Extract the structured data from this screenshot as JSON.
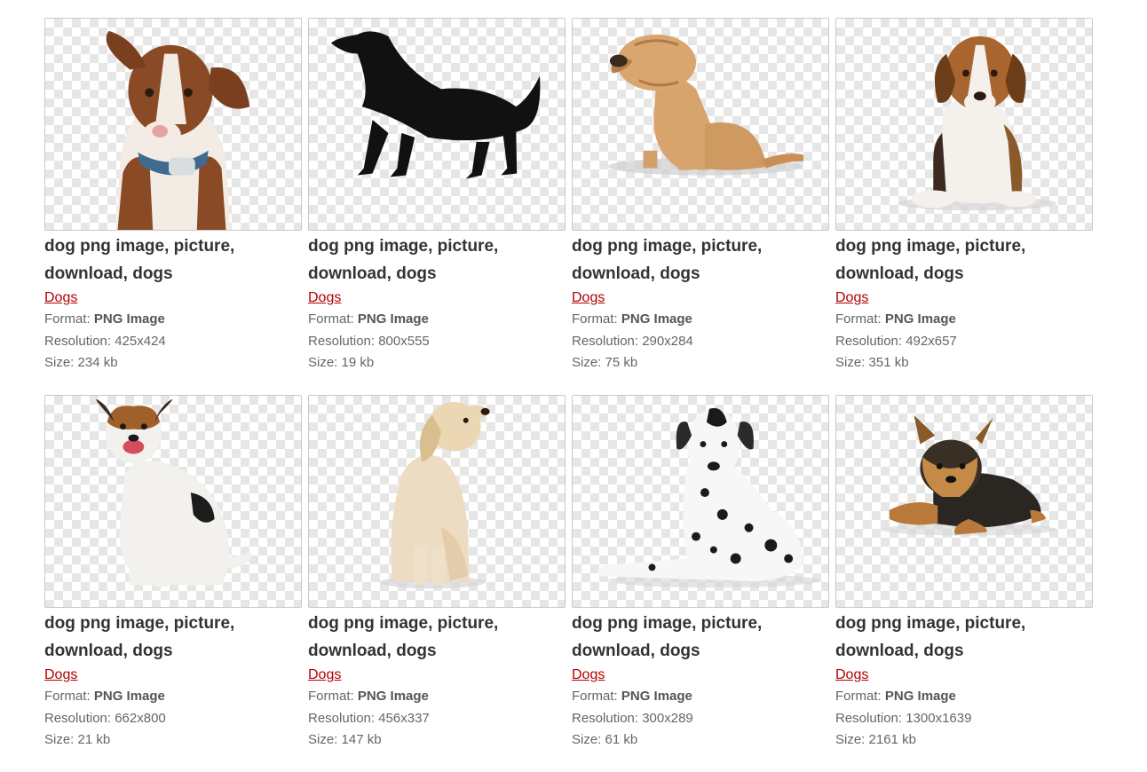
{
  "format_label": "Format:",
  "resolution_label": "Resolution:",
  "size_label": "Size:",
  "items": [
    {
      "title": "dog png image, picture, download, dogs",
      "category": "Dogs",
      "format": "PNG Image",
      "resolution": "425x424",
      "size": "234 kb",
      "thumbnail": "brown-white-puppy-icon"
    },
    {
      "title": "dog png image, picture, download, dogs",
      "category": "Dogs",
      "format": "PNG Image",
      "resolution": "800x555",
      "size": "19 kb",
      "thumbnail": "black-retriever-icon"
    },
    {
      "title": "dog png image, picture, download, dogs",
      "category": "Dogs",
      "format": "PNG Image",
      "resolution": "290x284",
      "size": "75 kb",
      "thumbnail": "shar-pei-icon"
    },
    {
      "title": "dog png image, picture, download, dogs",
      "category": "Dogs",
      "format": "PNG Image",
      "resolution": "492x657",
      "size": "351 kb",
      "thumbnail": "beagle-puppy-icon"
    },
    {
      "title": "dog png image, picture, download, dogs",
      "category": "Dogs",
      "format": "PNG Image",
      "resolution": "662x800",
      "size": "21 kb",
      "thumbnail": "jack-russell-icon"
    },
    {
      "title": "dog png image, picture, download, dogs",
      "category": "Dogs",
      "format": "PNG Image",
      "resolution": "456x337",
      "size": "147 kb",
      "thumbnail": "golden-puppy-icon"
    },
    {
      "title": "dog png image, picture, download, dogs",
      "category": "Dogs",
      "format": "PNG Image",
      "resolution": "300x289",
      "size": "61 kb",
      "thumbnail": "dalmatian-icon"
    },
    {
      "title": "dog png image, picture, download, dogs",
      "category": "Dogs",
      "format": "PNG Image",
      "resolution": "1300x1639",
      "size": "2161 kb",
      "thumbnail": "yorkshire-terrier-icon"
    }
  ]
}
